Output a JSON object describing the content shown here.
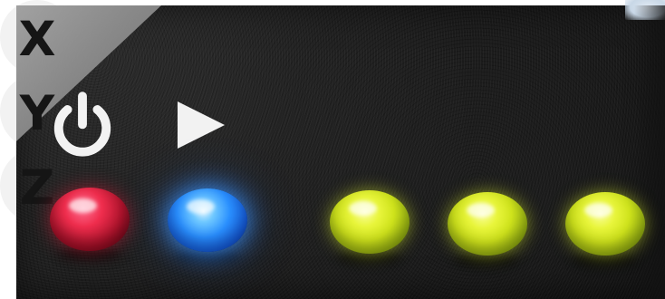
{
  "image": {
    "panel_color": "#1b1b1b",
    "corner_color": "#9a9a9a",
    "icon_color": "#f2f2f2",
    "letter_color": "#151515"
  },
  "icons": {
    "power": "power-icon",
    "play": "play-icon",
    "x_label": "X",
    "y_label": "Y",
    "z_label": "Z"
  },
  "leds": [
    {
      "name": "red-led",
      "color": "#e62a48"
    },
    {
      "name": "blue-led",
      "color": "#2a8fff"
    },
    {
      "name": "yellow-led",
      "color": "#d7ea1f"
    },
    {
      "name": "yellow-led",
      "color": "#d7ea1f"
    },
    {
      "name": "yellow-led",
      "color": "#d7ea1f"
    }
  ]
}
